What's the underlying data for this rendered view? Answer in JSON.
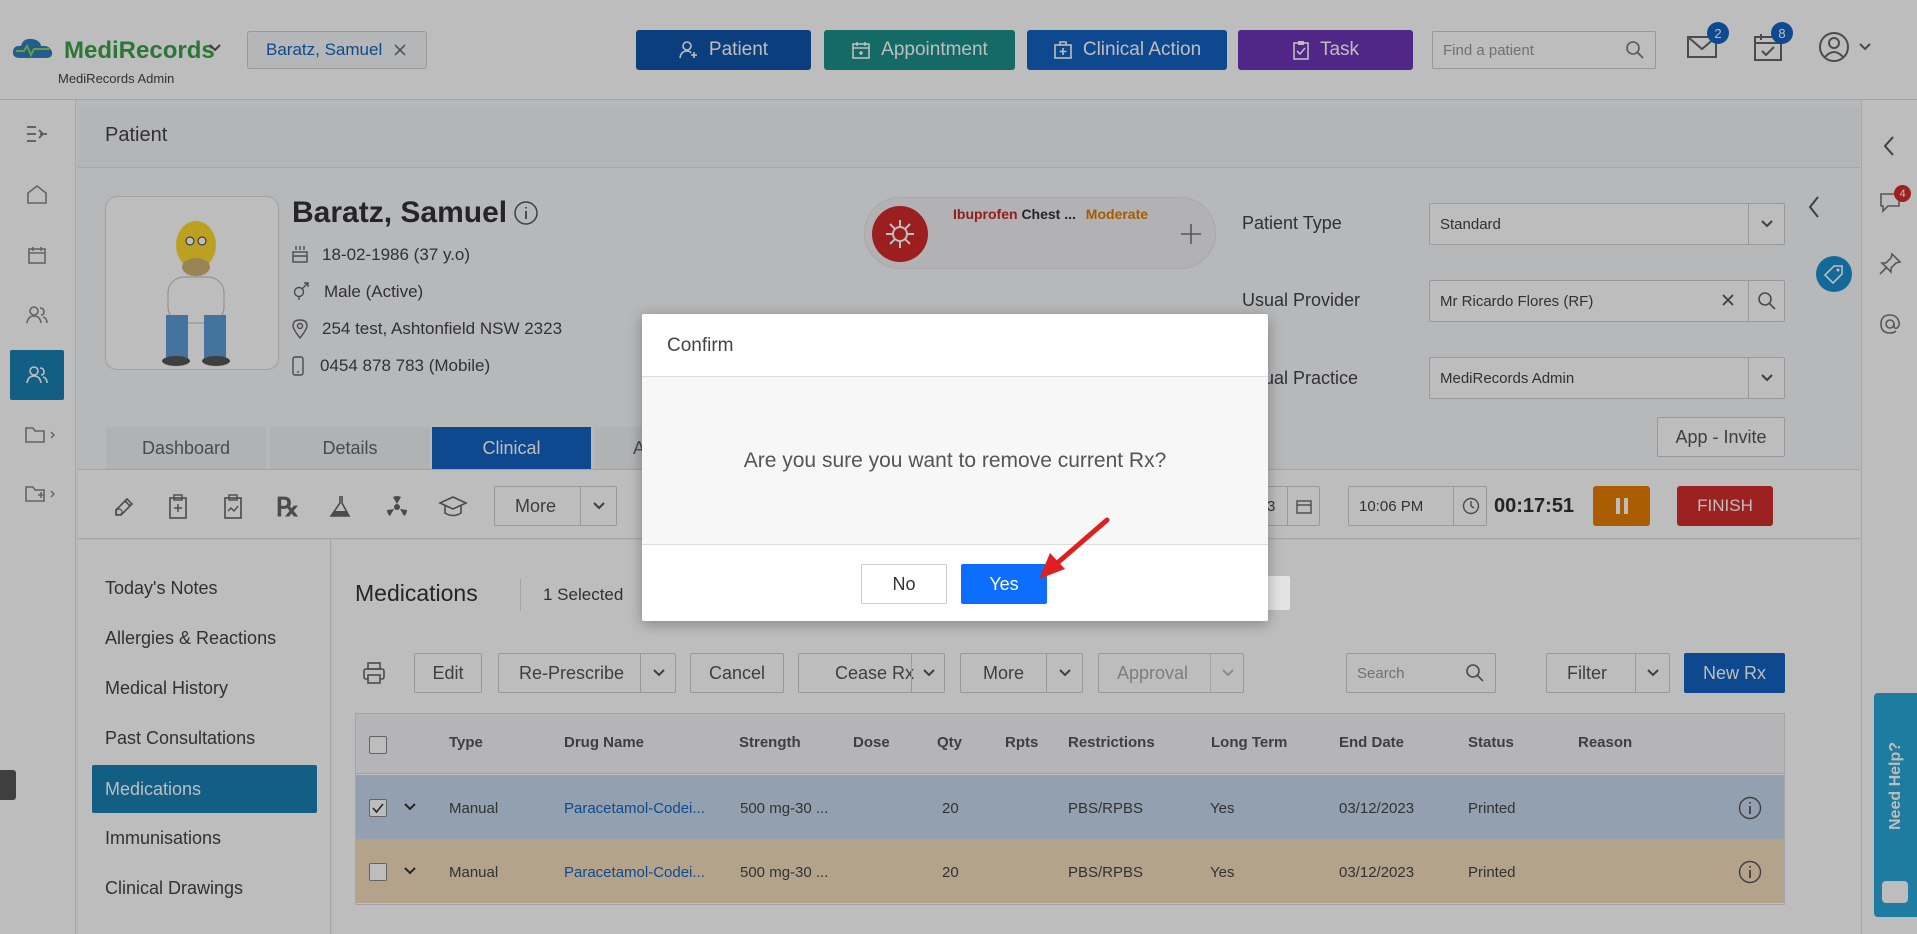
{
  "app": {
    "logo_text": "MediRecords",
    "org_name": "MediRecords Admin",
    "open_patient_tab": "Baratz, Samuel"
  },
  "header": {
    "buttons": [
      {
        "label": "Patient",
        "color": "#1054a8"
      },
      {
        "label": "Appointment",
        "color": "#1c8f8a"
      },
      {
        "label": "Clinical Action",
        "color": "#1462c0"
      },
      {
        "label": "Task",
        "color": "#6c35b6"
      }
    ],
    "search_placeholder": "Find a patient",
    "mail_count": "2",
    "tasks_count": "8"
  },
  "page": {
    "title": "Patient"
  },
  "patient": {
    "name": "Baratz, Samuel",
    "dob": "18-02-1986 (37 y.o)",
    "gender": "Male (Active)",
    "address": "254 test, Ashtonfield NSW 2323",
    "phone": "0454 878 783 (Mobile)"
  },
  "allergy": {
    "drug": "Ibuprofen",
    "reaction": "Chest ...",
    "severity": "Moderate"
  },
  "right_fields": {
    "patient_type_label": "Patient Type",
    "patient_type_value": "Standard",
    "usual_provider_label": "Usual Provider",
    "usual_provider_value": "Mr Ricardo Flores (RF)",
    "usual_practice_label": "ual Practice",
    "usual_practice_value": "MediRecords Admin",
    "app_invite": "App - Invite"
  },
  "tabs": [
    "Dashboard",
    "Details",
    "Clinical",
    "A"
  ],
  "toolbar": {
    "more": "More",
    "date_partial": "3",
    "time": "10:06 PM",
    "timer": "00:17:51",
    "finish": "FINISH"
  },
  "sidebar": {
    "items": [
      "Today's Notes",
      "Allergies & Reactions",
      "Medical History",
      "Past Consultations",
      "Medications",
      "Immunisations",
      "Clinical Drawings"
    ]
  },
  "medications": {
    "title": "Medications",
    "selected": "1 Selected",
    "actions": {
      "edit": "Edit",
      "represcribe": "Re-Prescribe",
      "cancel": "Cancel",
      "cease": "Cease Rx",
      "more": "More",
      "approval": "Approval",
      "search_placeholder": "Search",
      "filter": "Filter",
      "new_rx": "New Rx"
    },
    "columns": [
      "Type",
      "Drug Name",
      "Strength",
      "Dose",
      "Qty",
      "Rpts",
      "Restrictions",
      "Long Term",
      "End Date",
      "Status",
      "Reason"
    ],
    "rows": [
      {
        "type": "Manual",
        "drug": "Paracetamol-Codei...",
        "strength": "500 mg-30 ...",
        "dose": "",
        "qty": "20",
        "rpts": "",
        "restrictions": "PBS/RPBS",
        "long_term": "Yes",
        "end_date": "03/12/2023",
        "status": "Printed",
        "reason": "",
        "checked": true
      },
      {
        "type": "Manual",
        "drug": "Paracetamol-Codei...",
        "strength": "500 mg-30 ...",
        "dose": "",
        "qty": "20",
        "rpts": "",
        "restrictions": "PBS/RPBS",
        "long_term": "Yes",
        "end_date": "03/12/2023",
        "status": "Printed",
        "reason": "",
        "checked": false
      }
    ]
  },
  "help_widget": "Need Help?",
  "dialog": {
    "title": "Confirm",
    "message": "Are you sure you want to remove current Rx?",
    "no": "No",
    "yes": "Yes"
  },
  "icons": [
    "logo-cloud-icon",
    "chevron-down-icon",
    "close-icon",
    "user-plus-icon",
    "calendar-icon",
    "medical-bag-icon",
    "clipboard-icon",
    "search-icon",
    "mail-icon",
    "calendar-check-icon",
    "user-circle-icon",
    "collapse-menu-icon",
    "home-icon",
    "people-icon",
    "patient-icon",
    "folder-icon",
    "folder-add-icon",
    "chevron-left-icon",
    "chat-icon",
    "tag-icon",
    "pin-icon",
    "at-icon",
    "info-icon",
    "calendar-gift-icon",
    "gender-icon",
    "location-icon",
    "phone-icon",
    "virus-icon",
    "plus-icon",
    "note-edit-icon",
    "rx-icon",
    "flask-icon",
    "radiation-icon",
    "graduation-icon",
    "clock-icon",
    "pause-icon",
    "print-icon",
    "arrow-annotation-icon"
  ]
}
